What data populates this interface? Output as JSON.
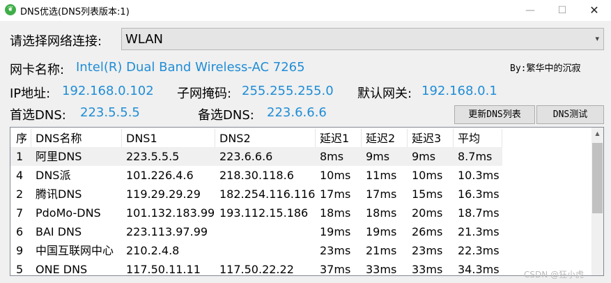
{
  "window": {
    "title": "DNS优选(DNS列表版本:1)",
    "icon": "leaf-icon",
    "minimize": "—",
    "maximize": "☐",
    "close": "✕"
  },
  "network": {
    "label": "请选择网络连接:",
    "selected": "WLAN"
  },
  "adapter": {
    "label": "网卡名称:",
    "value": "Intel(R) Dual Band Wireless-AC 7265"
  },
  "author": "By:繁华中的沉寂",
  "ip": {
    "label": "IP地址:",
    "value": "192.168.0.102"
  },
  "mask": {
    "label": "子网掩码:",
    "value": "255.255.255.0"
  },
  "gateway": {
    "label": "默认网关:",
    "value": "192.168.0.1"
  },
  "primary_dns": {
    "label": "首选DNS:",
    "value": "223.5.5.5"
  },
  "secondary_dns": {
    "label": "备选DNS:",
    "value": "223.6.6.6"
  },
  "buttons": {
    "update_list": "更新DNS列表",
    "test_dns": "DNS测试"
  },
  "table": {
    "columns": [
      "序",
      "DNS名称",
      "DNS1",
      "DNS2",
      "延迟1",
      "延迟2",
      "延迟3",
      "平均"
    ],
    "rows": [
      [
        "1",
        "阿里DNS",
        "223.5.5.5",
        "223.6.6.6",
        "8ms",
        "9ms",
        "9ms",
        "8.7ms"
      ],
      [
        "4",
        "DNS派",
        "101.226.4.6",
        "218.30.118.6",
        "10ms",
        "11ms",
        "10ms",
        "10.3ms"
      ],
      [
        "2",
        "腾讯DNS",
        "119.29.29.29",
        "182.254.116.116",
        "17ms",
        "17ms",
        "15ms",
        "16.3ms"
      ],
      [
        "7",
        "PdoMo-DNS",
        "101.132.183.99",
        "193.112.15.186",
        "18ms",
        "18ms",
        "20ms",
        "18.7ms"
      ],
      [
        "6",
        "BAI DNS",
        "223.113.97.99",
        "",
        "19ms",
        "19ms",
        "26ms",
        "21.3ms"
      ],
      [
        "9",
        "中国互联网中心",
        "210.2.4.8",
        "",
        "23ms",
        "21ms",
        "23ms",
        "22.3ms"
      ],
      [
        "5",
        "ONE DNS",
        "117.50.11.11",
        "117.50.22.22",
        "37ms",
        "33ms",
        "33ms",
        "34.3ms"
      ]
    ]
  },
  "watermark": "CSDN @狂小虎",
  "colors": {
    "accent": "#1f8dd6",
    "icon": "#3fae49"
  }
}
